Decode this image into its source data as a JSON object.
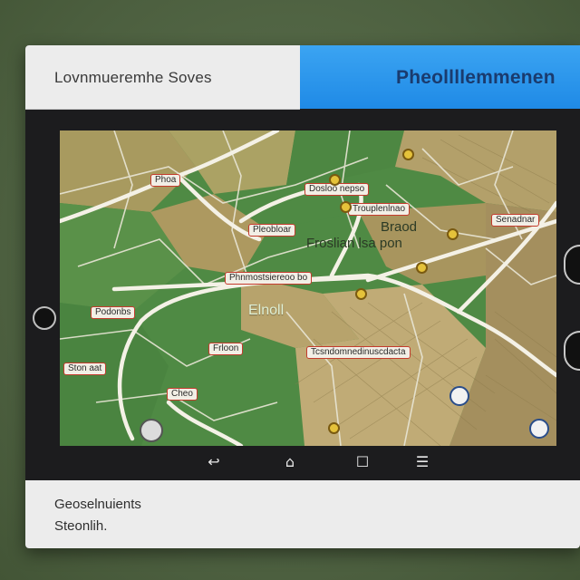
{
  "header": {
    "left_title": "Lovnmueremhe Soves",
    "right_title": "Pheollllemmenen"
  },
  "map": {
    "labels": [
      "Phoa",
      "Dosloo nepso",
      "Trouplenlnao",
      "Pleobloar",
      "Phnmostsiereoo bo",
      "Senadnar",
      "Podonbs",
      "Tcsndomnedinuscdacta",
      "Frloon",
      "Ston aat",
      "Cheo"
    ],
    "area_texts": {
      "a": "Braod",
      "b": "Froslian lsa pon",
      "c": "Elnoll"
    },
    "colors": {
      "land": "#4f8a44",
      "urban": "#b19a61",
      "road": "#f4f1e6",
      "label_border": "#c43b2d"
    }
  },
  "navbar": {
    "back_icon": "↩",
    "home_icon": "⌂",
    "recents_icon": "☐",
    "menu_icon": "☰"
  },
  "footer": {
    "line1": "Geoselnuients",
    "line2": "Steonlih."
  }
}
